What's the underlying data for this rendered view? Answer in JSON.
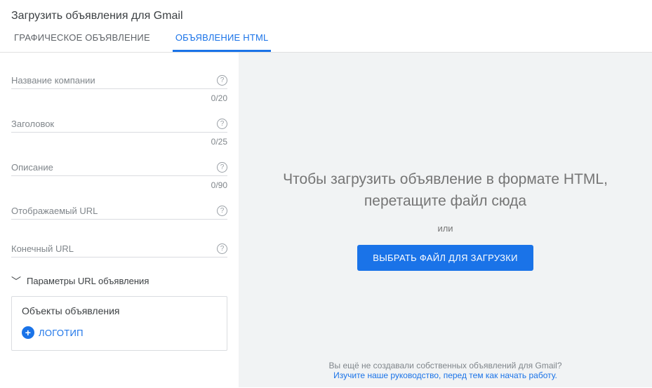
{
  "header": {
    "title": "Загрузить объявления для Gmail"
  },
  "tabs": {
    "graphic": "ГРАФИЧЕСКОЕ ОБЪЯВЛЕНИЕ",
    "html": "ОБЪЯВЛЕНИЕ HTML"
  },
  "fields": {
    "company": {
      "label": "Название компании",
      "counter": "0/20"
    },
    "headline": {
      "label": "Заголовок",
      "counter": "0/25"
    },
    "description": {
      "label": "Описание",
      "counter": "0/90"
    },
    "display_url": {
      "label": "Отображаемый URL"
    },
    "final_url": {
      "label": "Конечный URL"
    }
  },
  "expander": {
    "label": "Параметры URL объявления"
  },
  "assets": {
    "title": "Объекты объявления",
    "logo_label": "ЛОГОТИП"
  },
  "dropzone": {
    "line": "Чтобы загрузить объявление в формате HTML, перетащите файл сюда",
    "or": "или",
    "button": "ВЫБРАТЬ ФАЙЛ ДЛЯ ЗАГРУЗКИ"
  },
  "footer": {
    "question": "Вы ещё не создавали собственных объявлений для Gmail?",
    "link": "Изучите наше руководство, перед тем как начать работу."
  },
  "icons": {
    "help": "?",
    "plus": "+"
  }
}
